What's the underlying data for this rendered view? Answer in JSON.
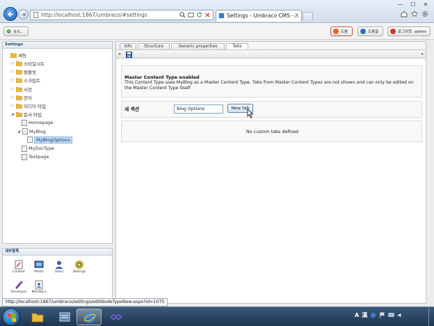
{
  "browser": {
    "address": "http://localhost:1867/umbraco/#settings",
    "tab_title": "Settings - Umbraco CMS -...",
    "tab_close": "×",
    "win_min": "—",
    "win_max": "☐",
    "win_close": "✕"
  },
  "topbar": {
    "search_label": "검색...",
    "help_label": "도움",
    "about_label": "도움말",
    "logout_label": "로그아웃: admin"
  },
  "tree": {
    "header": "Settings",
    "root": "세팅",
    "items": [
      "스타일시트",
      "템플릿",
      "스크립트",
      "사전",
      "언어",
      "미디어 타입",
      "문서 타입"
    ],
    "doc_types": [
      "Homepage",
      "MyBlog",
      "MyBlogOptions",
      "MyDocType",
      "Textpage"
    ]
  },
  "sections": {
    "header": "세부항목",
    "apps": [
      "Content",
      "Media",
      "Users",
      "Settings",
      "Developer",
      "Members"
    ]
  },
  "editor": {
    "tabs": [
      "Info",
      "Structure",
      "Generic properties",
      "Tabs"
    ],
    "arrow_left": "◂",
    "arrow_right": "▸",
    "master_title": "Master Content Type enabled",
    "master_desc": "This Content Type uses MyBlog as a Master Content Type. Tabs from Master Content Types are not shown and can only be edited on the Master Content Type itself",
    "new_section_label": "새 섹션",
    "new_tab_value": "Blog Options",
    "new_tab_button": "New tab",
    "no_tabs_text": "No custom tabs defined"
  },
  "status": {
    "url": "http://localhost:1867/umbraco/settings/editNodeTypeNew.aspx?id=1075"
  },
  "taskbar": {
    "lang": "A",
    "ime": "漢"
  },
  "colors": {
    "accent": "#1c5cb3",
    "selected": "#c4dcf5",
    "help": "#e8642a"
  }
}
